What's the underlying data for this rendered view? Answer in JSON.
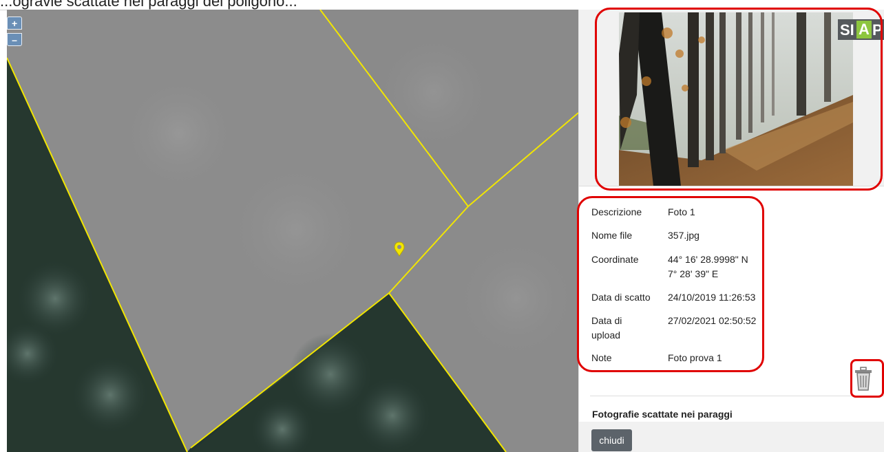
{
  "top_strip": {
    "text": "...ogravie scattate nei paraggi del poligono..."
  },
  "map": {
    "zoom_in": "+",
    "zoom_out": "–",
    "boundary_color": "#f2e600",
    "marker_color": "#f2e600"
  },
  "panel": {
    "logo": {
      "s": "SI",
      "a": "A",
      "p": "P"
    },
    "details": [
      {
        "label": "Descrizione",
        "value": "Foto 1"
      },
      {
        "label": "Nome file",
        "value": "357.jpg"
      },
      {
        "label": "Coordinate",
        "value": "44° 16' 28.9998\" N",
        "value2": "7° 28' 39\" E"
      },
      {
        "label": "Data di scatto",
        "value": "24/10/2019 11:26:53"
      },
      {
        "label": "Data di",
        "label2": "upload",
        "value": "27/02/2021 02:50:52"
      },
      {
        "label": "Note",
        "value": "Foto prova 1"
      }
    ],
    "nearby_title": "Fotografie scattate nei paraggi",
    "close_label": "chiudi"
  },
  "annotation_color": "#e00000"
}
